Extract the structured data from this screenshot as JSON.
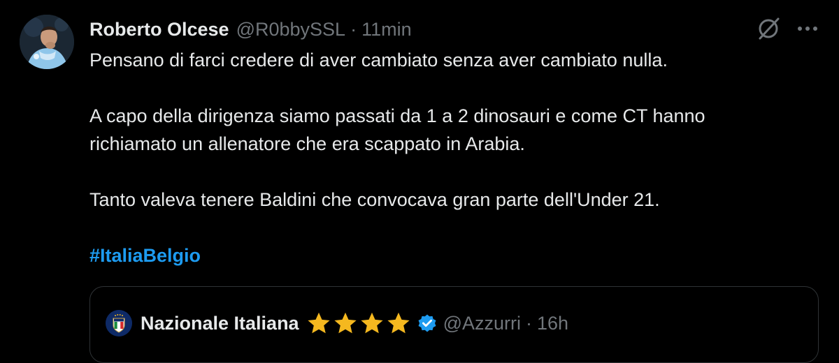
{
  "tweet": {
    "author": {
      "name": "Roberto Olcese",
      "handle": "@R0bbySSL",
      "time": "11min",
      "separator": "·"
    },
    "body": {
      "line1": "Pensano di farci credere di aver cambiato senza aver cambiato nulla.",
      "line2": "A capo della dirigenza siamo passati da 1 a 2 dinosauri e come CT hanno",
      "line3": "richiamato un allenatore che era scappato in Arabia.",
      "line4": "Tanto valeva tenere Baldini che convocava gran parte dell'Under 21.",
      "hashtag": "#ItaliaBelgio"
    },
    "icons": {
      "grok": "grok-icon",
      "more": "more-icon"
    }
  },
  "quoted": {
    "name": "Nazionale Italiana",
    "stars": [
      "star",
      "star",
      "star",
      "star"
    ],
    "verified": "verified-badge",
    "handle": "@Azzurri",
    "separator": "·",
    "time": "16h",
    "avatar_badge": "ITALIA"
  },
  "colors": {
    "background": "#000000",
    "text": "#e7e9ea",
    "muted": "#71767b",
    "link": "#1d9bf0",
    "border": "#2f3336",
    "star": "#f5b81f"
  }
}
